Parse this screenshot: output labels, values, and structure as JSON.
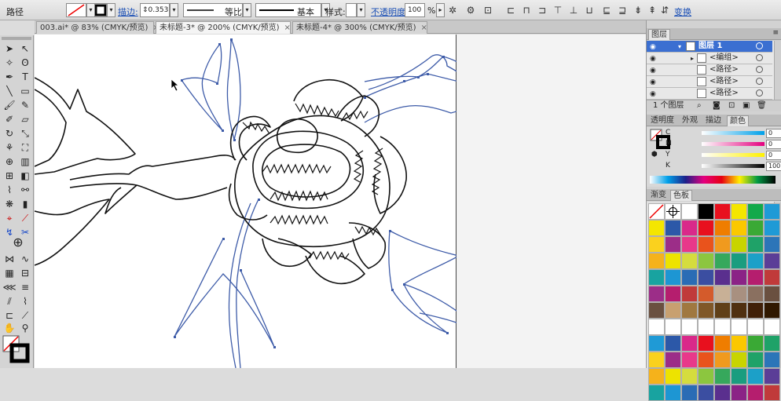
{
  "control_bar": {
    "object_type": "路径",
    "stroke_label": "描边:",
    "stroke_weight": "0.353",
    "profile_label": "等比",
    "brush_label": "基本",
    "style_label": "样式:",
    "opacity_label": "不透明度:",
    "opacity_value": "100",
    "opacity_unit": "%",
    "transform_label": "变换"
  },
  "tabs": [
    {
      "label": "003.ai* @ 83% (CMYK/预览)",
      "close": "×"
    },
    {
      "label": "未标题-3* @ 200% (CMYK/预览)",
      "close": "×"
    },
    {
      "label": "未标题-4* @ 300% (CMYK/预览)",
      "close": "×"
    }
  ],
  "layers_panel": {
    "title": "图层",
    "rows": [
      {
        "name": "图层 1"
      },
      {
        "name": "<编组>"
      },
      {
        "name": "<路径>"
      },
      {
        "name": "<路径>"
      },
      {
        "name": "<路径>"
      }
    ],
    "footer": "1 个图层"
  },
  "color_panel": {
    "tabs": [
      "透明度",
      "外观",
      "描边",
      "颜色"
    ],
    "channels": [
      {
        "label": "C",
        "value": "0"
      },
      {
        "label": "M",
        "value": "0"
      },
      {
        "label": "Y",
        "value": "0"
      },
      {
        "label": "K",
        "value": "100"
      }
    ]
  },
  "swatches_panel": {
    "tabs": [
      "渐变",
      "色板"
    ],
    "row1": [
      "#ffffff",
      "#ffffff",
      "#ffffff",
      "#000000",
      "#e8101e",
      "#f4e600",
      "#12a94a",
      "#1f9ad6"
    ],
    "grid": [
      [
        "#f4e600",
        "#2c58a8",
        "#d9298a",
        "#e8101e",
        "#ef7d00",
        "#fbc800",
        "#3aa935",
        "#1f9ad6"
      ],
      [
        "#fad11e",
        "#9c2d88",
        "#e8388a",
        "#e9531c",
        "#f09a1e",
        "#c8d400",
        "#1fa268",
        "#2c75b8"
      ],
      [
        "#f5b21b",
        "#ede300",
        "#d5dc3e",
        "#8cc63f",
        "#36a85c",
        "#1a9d7f",
        "#1ca0c8",
        "#5b3e97"
      ],
      [
        "#18a3a0",
        "#1d96d3",
        "#2a6cb5",
        "#3b4ea1",
        "#5a2f8e",
        "#8b2386",
        "#b51e6e",
        "#c03a3a"
      ],
      [
        "#9c2d88",
        "#b51e6e",
        "#c03a3a",
        "#d45b2b",
        "#c8b096",
        "#a89080",
        "#8a7060",
        "#6a5040"
      ],
      [
        "#6a5040",
        "#c8a070",
        "#a07840",
        "#805828",
        "#604018",
        "#503010",
        "#402008",
        "#301800"
      ],
      [
        "#ffffff",
        "#ffffff",
        "#ffffff",
        "#ffffff",
        "#ffffff",
        "#ffffff",
        "#ffffff",
        "#ffffff"
      ],
      [
        "#1f9ad6",
        "#2c58a8",
        "#d9298a",
        "#e8101e",
        "#ef7d00",
        "#fbc800",
        "#3aa935",
        "#1fa268"
      ],
      [
        "#fad11e",
        "#9c2d88",
        "#e8388a",
        "#e9531c",
        "#f09a1e",
        "#c8d400",
        "#1fa268",
        "#2c75b8"
      ],
      [
        "#f5b21b",
        "#ede300",
        "#d5dc3e",
        "#8cc63f",
        "#36a85c",
        "#1a9d7f",
        "#1ca0c8",
        "#5b3e97"
      ],
      [
        "#18a3a0",
        "#1d96d3",
        "#2a6cb5",
        "#3b4ea1",
        "#5a2f8e",
        "#8b2386",
        "#b51e6e",
        "#c03a3a"
      ]
    ]
  },
  "colors": {
    "selection_path": "#3d5ba8",
    "anchor": "#3d5ba8",
    "art_stroke": "#111111",
    "link_blue": "#1a4fb6",
    "layer_highlight": "#3b6fd1"
  }
}
